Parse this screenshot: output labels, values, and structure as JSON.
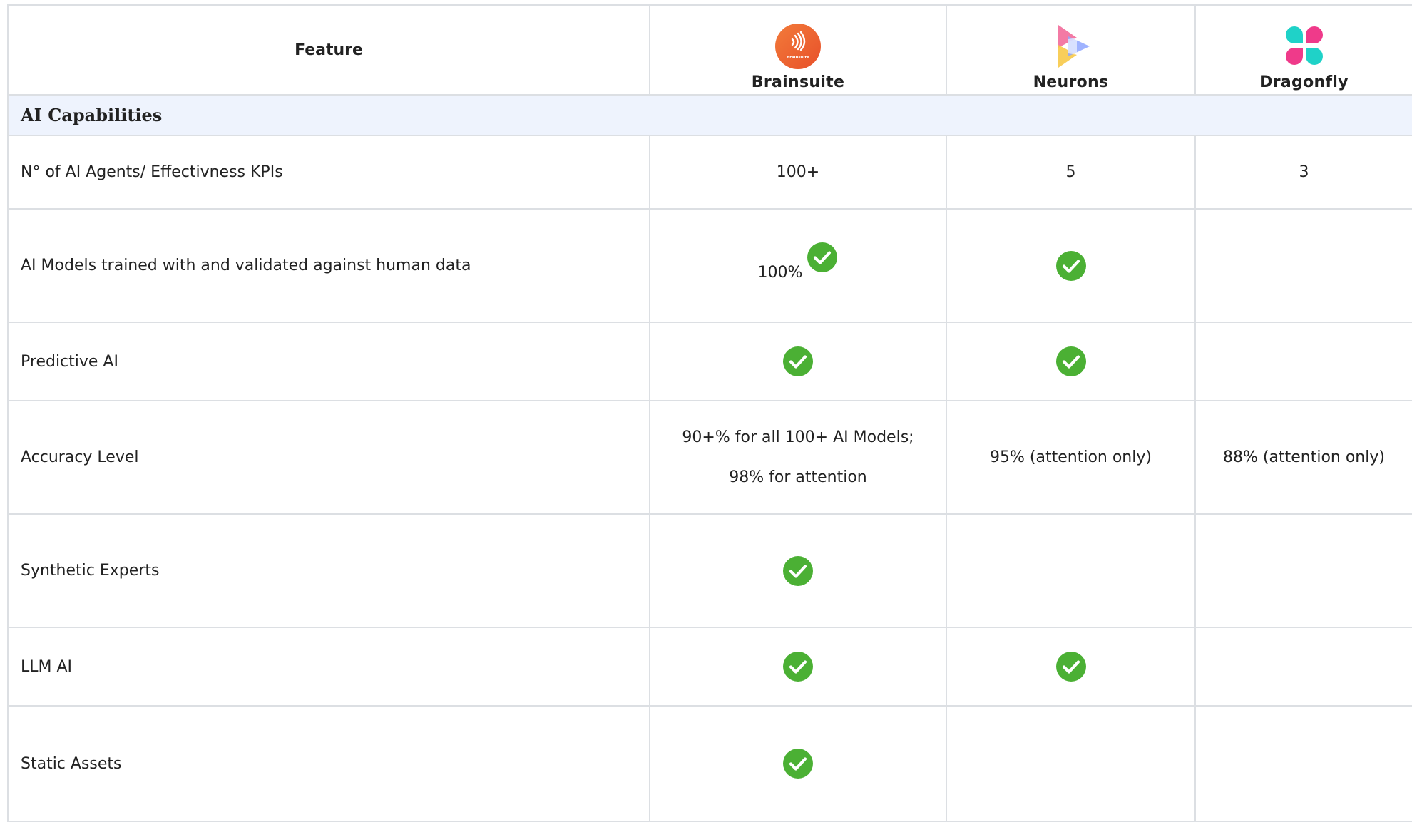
{
  "table": {
    "header": {
      "feature": "Feature",
      "brainsuite": "Brainsuite",
      "neurons": "Neurons",
      "dragonfly": "Dragonfly"
    },
    "logos": {
      "brainsuite_logo_text": "Brainsuite",
      "brainsuite_color": "#f0622d",
      "neurons_colors": [
        "#f26b9a",
        "#f7c948",
        "#8ea6ff"
      ],
      "dragonfly_colors": [
        "#1fd2c8",
        "#ef3a8a"
      ]
    },
    "section": {
      "title": "AI Capabilities"
    },
    "rows": [
      {
        "feature": "N° of AI Agents/ Effectivness KPIs",
        "brainsuite": "100+",
        "neurons": "5",
        "dragonfly": "3"
      },
      {
        "feature": "AI Models trained with and validated against human data",
        "brainsuite": "100%",
        "brainsuite_check": true,
        "neurons_check": true,
        "dragonfly_check": false
      },
      {
        "feature": "Predictive AI",
        "brainsuite_check": true,
        "neurons_check": true,
        "dragonfly_check": false
      },
      {
        "feature": "Accuracy Level",
        "brainsuite_line1": "90+% for all 100+ AI Models;",
        "brainsuite_line2": "98% for attention",
        "neurons": "95% (attention only)",
        "dragonfly": "88% (attention only)"
      },
      {
        "feature": "Synthetic Experts",
        "brainsuite_check": true,
        "neurons_check": false,
        "dragonfly_check": false
      },
      {
        "feature": "LLM AI",
        "brainsuite_check": true,
        "neurons_check": true,
        "dragonfly_check": false
      },
      {
        "feature": "Static Assets",
        "brainsuite_check": true,
        "neurons_check": false,
        "dragonfly_check": false
      }
    ],
    "check_color": "#4bb034"
  }
}
